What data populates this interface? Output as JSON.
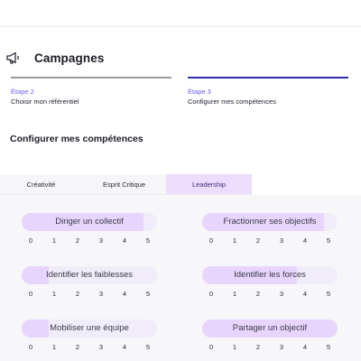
{
  "header": {
    "title": "Campagnes",
    "icon": "megaphone-icon"
  },
  "stepper": [
    {
      "num": "Étape 2",
      "label": "Choisir mon référentiel",
      "active": false
    },
    {
      "num": "Étape 3",
      "label": "Configurer mes compétences",
      "active": true
    }
  ],
  "section_title": "Configurer mes compétences",
  "tabs": [
    {
      "label": "Créativité",
      "selected": false
    },
    {
      "label": "Esprit Critique",
      "selected": false
    },
    {
      "label": "Leadership",
      "selected": true
    }
  ],
  "scale": [
    "0",
    "1",
    "2",
    "3",
    "4",
    "5"
  ],
  "skills": [
    {
      "name": "Diriger un collectif",
      "level": 4.5
    },
    {
      "name": "Fractionner ses objectifs",
      "level": 4.5
    },
    {
      "name": "Identifier les faiblesses",
      "level": 1.0
    },
    {
      "name": "Identifier les forces",
      "level": 3.5
    },
    {
      "name": "Mobiliser une équipe",
      "level": 1.0
    },
    {
      "name": "Partager un objectif",
      "level": 5.0
    }
  ],
  "colors": {
    "accent": "#6b5cf6",
    "active_step": "#2f2fa8",
    "tab_selected": "#ecdcfd",
    "fill": "#e8d5fd"
  }
}
